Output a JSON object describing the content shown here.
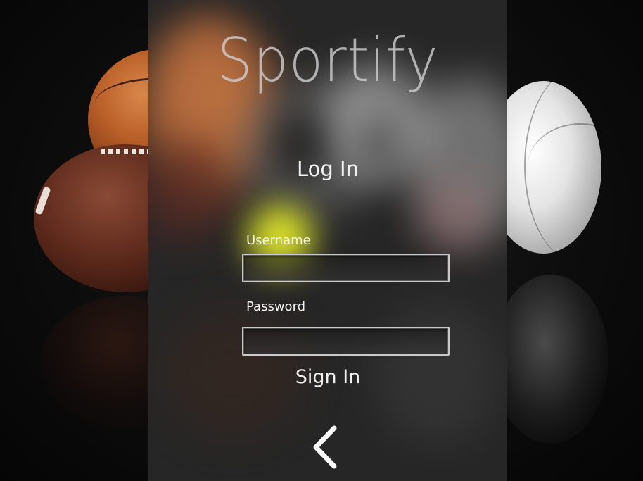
{
  "app": {
    "title": "Sportify"
  },
  "login": {
    "heading": "Log In",
    "username": {
      "label": "Username",
      "value": "",
      "placeholder": ""
    },
    "password": {
      "label": "Password",
      "value": "",
      "placeholder": ""
    },
    "submit_label": "Sign In"
  },
  "navigation": {
    "back_icon": "chevron-left-icon"
  },
  "colors": {
    "panel": "#262626",
    "text": "#f2f2f2",
    "title": "#cdcdcd",
    "field_border": "#c9c9c9",
    "highlight": "#e8f02a"
  }
}
